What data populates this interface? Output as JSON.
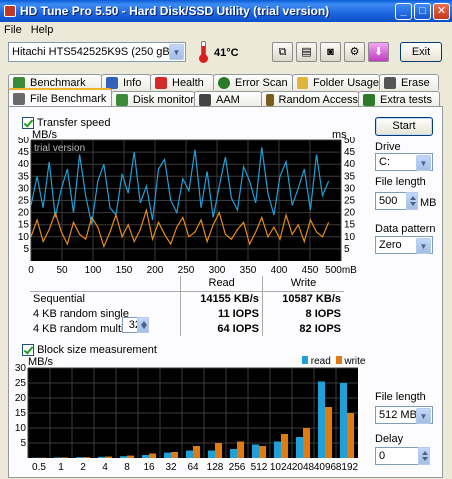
{
  "window": {
    "title": "HD Tune Pro 5.50 - Hard Disk/SSD Utility (trial version)",
    "minimize": "_",
    "maximize": "□",
    "close": "✕"
  },
  "menu": [
    "File",
    "Help"
  ],
  "toolbar": {
    "drive": "Hitachi HTS542525K9S (250 gB)",
    "temperature": "41°C",
    "exit_label": "Exit"
  },
  "tabs_top": [
    {
      "label": "Benchmark",
      "icon": "benchmark-icon",
      "color": "#3a8a3a"
    },
    {
      "label": "Info",
      "icon": "info-icon",
      "color": "#3262b8"
    },
    {
      "label": "Health",
      "icon": "health-icon",
      "color": "#d22a2a"
    },
    {
      "label": "Error Scan",
      "icon": "error-scan-icon",
      "color": "#2a7a2a"
    },
    {
      "label": "Folder Usage",
      "icon": "folder-icon",
      "color": "#e0b63a"
    },
    {
      "label": "Erase",
      "icon": "erase-icon",
      "color": "#555555"
    }
  ],
  "tabs_bottom": [
    {
      "label": "File Benchmark",
      "icon": "file-benchmark-icon",
      "color": "#6a6a6a",
      "active": true
    },
    {
      "label": "Disk monitor",
      "icon": "disk-monitor-icon",
      "color": "#3a8a3a"
    },
    {
      "label": "AAM",
      "icon": "aam-icon",
      "color": "#444444"
    },
    {
      "label": "Random Access",
      "icon": "random-access-icon",
      "color": "#7b5b1e"
    },
    {
      "label": "Extra tests",
      "icon": "extra-tests-icon",
      "color": "#2a7a2a"
    }
  ],
  "transfer": {
    "checkbox_label": "Transfer speed",
    "unit_left": "MB/s",
    "unit_right": "ms",
    "watermark": "trial version"
  },
  "side": {
    "start_label": "Start",
    "drive_label": "Drive",
    "drive_value": "C:",
    "file_length_label": "File length",
    "file_length_value": "500",
    "file_length_unit": "MB",
    "pattern_label": "Data pattern",
    "pattern_value": "Zero",
    "file_length2_label": "File length",
    "file_length2_value": "512 MB",
    "delay_label": "Delay",
    "delay_value": "0"
  },
  "results": {
    "head": [
      "",
      "Read",
      "Write"
    ],
    "rows": [
      {
        "label": "Sequential",
        "read": "14155 KB/s",
        "write": "10587 KB/s"
      },
      {
        "label": "4 KB random single",
        "read": "11 IOPS",
        "write": "8 IOPS"
      },
      {
        "label": "4 KB random multi",
        "read": "64 IOPS",
        "write": "82 IOPS"
      }
    ],
    "queue_depth": "32"
  },
  "block": {
    "checkbox_label": "Block size measurement",
    "unit": "MB/s",
    "legend_read": "read",
    "legend_write": "write"
  },
  "chart_data": [
    {
      "type": "line",
      "x_ticks": [
        "0",
        "50",
        "100",
        "150",
        "200",
        "250",
        "300",
        "350",
        "400",
        "450",
        "500mB"
      ],
      "y_ticks_left": [
        "50",
        "45",
        "40",
        "35",
        "30",
        "25",
        "20",
        "15",
        "10",
        "5"
      ],
      "y_ticks_right": [
        "50",
        "45",
        "40",
        "35",
        "30",
        "25",
        "20",
        "15",
        "10",
        "5"
      ],
      "xlim": [
        0,
        500
      ],
      "ylim": [
        0,
        50
      ],
      "grid": true,
      "series": [
        {
          "color": "#1fa0d8",
          "values": [
            23,
            35,
            22,
            41,
            18,
            30,
            38,
            20,
            44,
            27,
            15,
            33,
            40,
            22,
            19,
            36,
            28,
            45,
            24,
            31,
            17,
            38,
            42,
            25,
            20,
            34,
            29,
            46,
            22,
            37,
            18,
            31,
            43,
            26,
            21,
            39,
            33,
            24,
            47,
            28,
            19,
            35,
            41,
            23,
            30,
            38,
            21,
            44,
            27,
            33
          ]
        },
        {
          "color": "#e88a1a",
          "values": [
            10,
            17,
            8,
            13,
            20,
            12,
            7,
            16,
            11,
            9,
            18,
            14,
            6,
            12,
            19,
            10,
            15,
            8,
            13,
            21,
            9,
            16,
            11,
            7,
            14,
            18,
            10,
            12,
            17,
            8,
            15,
            20,
            11,
            9,
            13,
            16,
            7,
            12,
            18,
            10,
            14,
            9,
            19,
            11,
            15,
            8,
            17,
            12,
            10,
            16
          ]
        }
      ]
    },
    {
      "type": "bar",
      "categories": [
        "0.5",
        "1",
        "2",
        "4",
        "8",
        "16",
        "32",
        "64",
        "128",
        "256",
        "512",
        "1024",
        "2048",
        "4096",
        "8192"
      ],
      "ylim": [
        0,
        30
      ],
      "y_ticks": [
        "30",
        "25",
        "20",
        "15",
        "10",
        "5"
      ],
      "grid": true,
      "series": [
        {
          "name": "read",
          "color": "#1fa0d8",
          "values": [
            0.1,
            0.2,
            0.3,
            0.4,
            0.6,
            1.0,
            1.8,
            2.5,
            2.5,
            3.0,
            4.5,
            5.5,
            7.0,
            25.5,
            25.0
          ]
        },
        {
          "name": "write",
          "color": "#e07b12",
          "values": [
            0.1,
            0.2,
            0.3,
            0.5,
            0.8,
            1.5,
            2.0,
            4.0,
            5.0,
            5.5,
            4.0,
            8.0,
            10.0,
            17.0,
            15.0
          ]
        }
      ]
    }
  ]
}
